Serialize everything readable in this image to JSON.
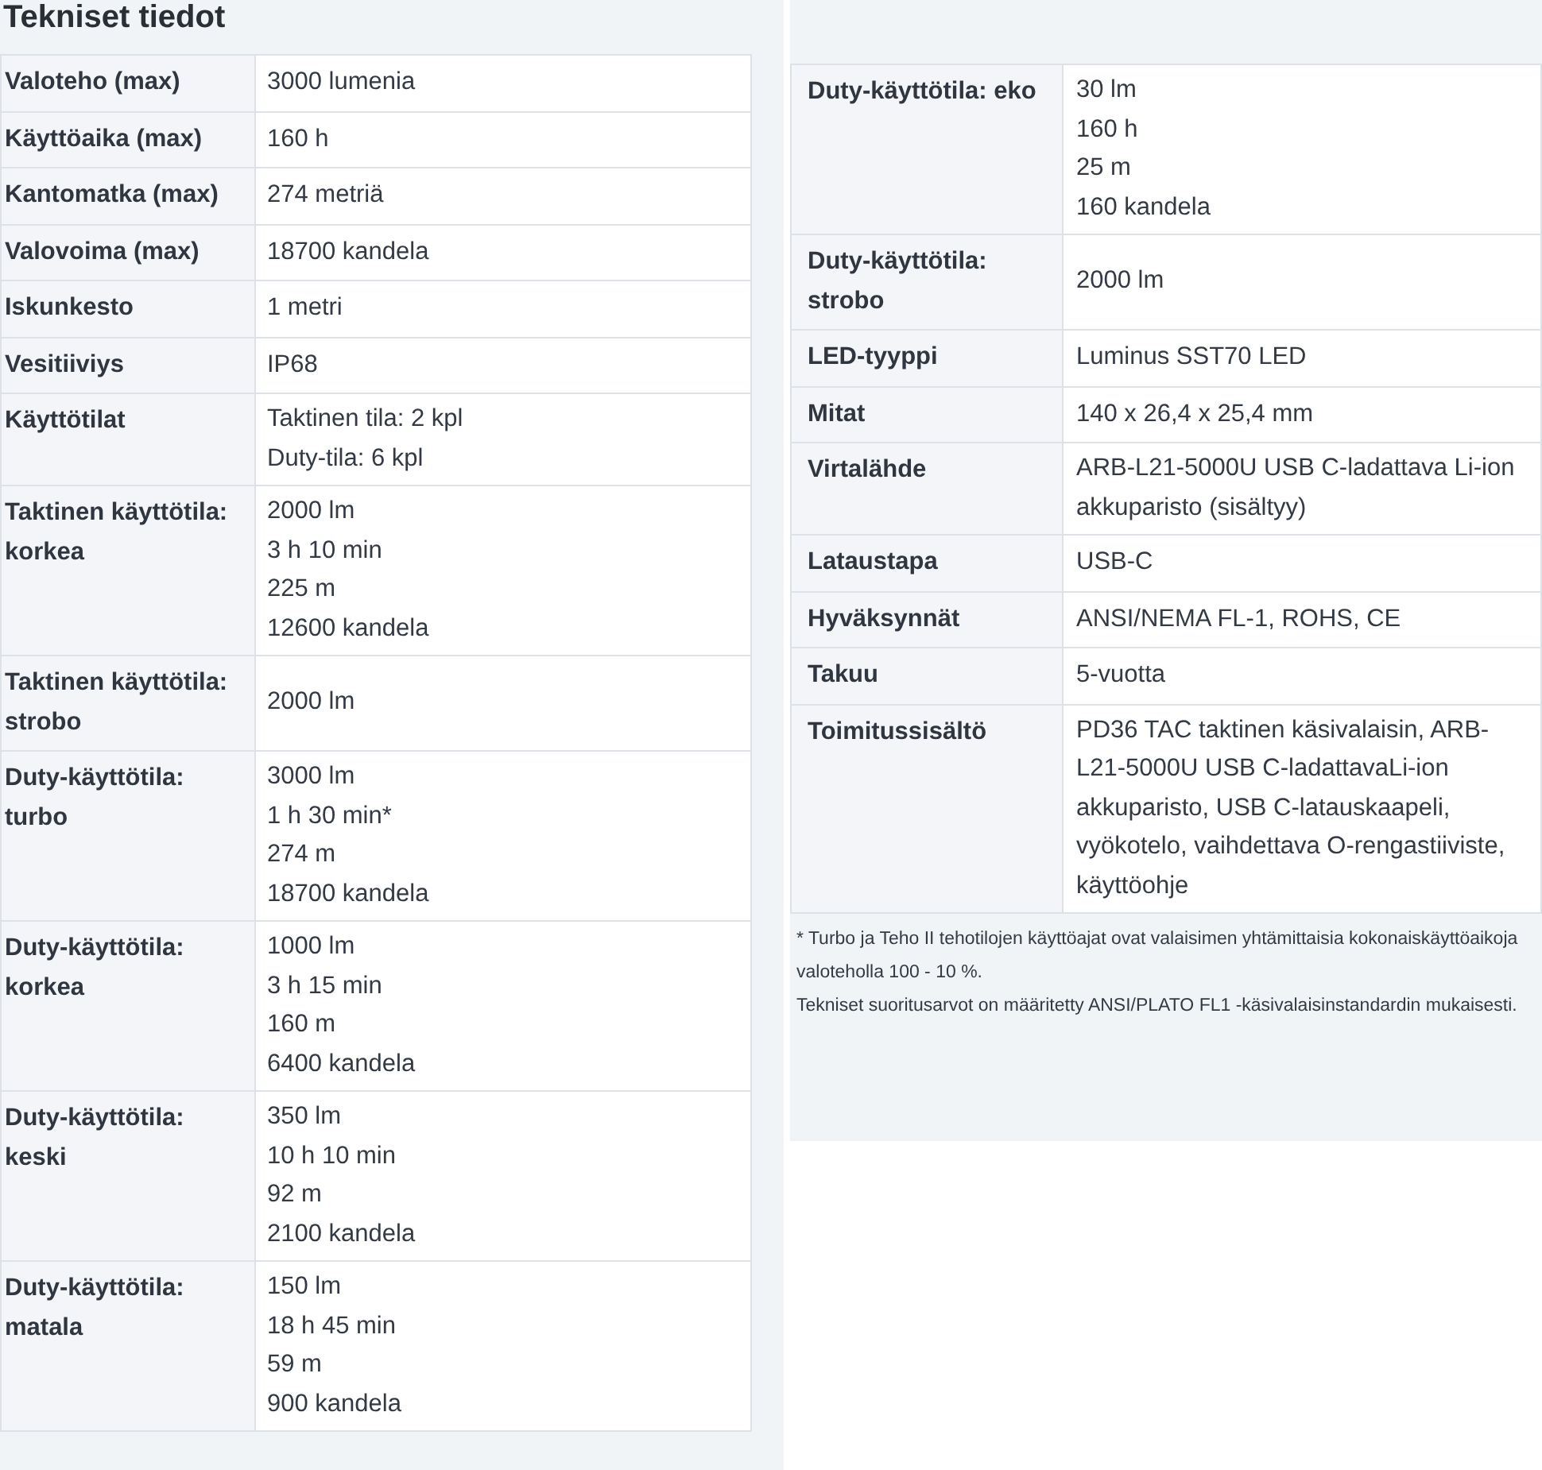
{
  "title": "Tekniset tiedot",
  "left_table": {
    "rows": [
      {
        "label": "Valoteho (max)",
        "value": [
          "3000 lumenia"
        ]
      },
      {
        "label": "Käyttöaika (max)",
        "value": [
          "160 h"
        ]
      },
      {
        "label": "Kantomatka (max)",
        "value": [
          "274 metriä"
        ]
      },
      {
        "label": "Valovoima (max)",
        "value": [
          "18700 kandela"
        ]
      },
      {
        "label": "Iskunkesto",
        "value": [
          "1 metri"
        ]
      },
      {
        "label": "Vesitiiviys",
        "value": [
          "IP68"
        ]
      },
      {
        "label": "Käyttötilat",
        "value": [
          "Taktinen tila: 2 kpl",
          "Duty-tila: 6 kpl"
        ]
      },
      {
        "label": "Taktinen käyttötila: korkea",
        "value": [
          "2000 lm",
          "3 h 10 min",
          "225 m",
          "12600 kandela"
        ]
      },
      {
        "label": "Taktinen käyttötila: strobo",
        "value": [
          "2000 lm"
        ]
      },
      {
        "label": "Duty-käyttötila: turbo",
        "value": [
          "3000 lm",
          "1 h 30 min*",
          "274 m",
          "18700 kandela"
        ]
      },
      {
        "label": "Duty-käyttötila: korkea",
        "value": [
          "1000 lm",
          "3 h 15 min",
          "160 m",
          "6400 kandela"
        ]
      },
      {
        "label": "Duty-käyttötila: keski",
        "value": [
          "350 lm",
          "10 h 10 min",
          "92 m",
          "2100 kandela"
        ]
      },
      {
        "label": "Duty-käyttötila: matala",
        "value": [
          "150 lm",
          "18 h 45 min",
          "59 m",
          "900 kandela"
        ]
      }
    ]
  },
  "right_table": {
    "rows": [
      {
        "label": "Duty-käyttötila: eko",
        "value": [
          "30 lm",
          "160 h",
          "25 m",
          "160 kandela"
        ]
      },
      {
        "label": "Duty-käyttötila: strobo",
        "value": [
          "2000 lm"
        ]
      },
      {
        "label": "LED-tyyppi",
        "value": [
          "Luminus SST70 LED"
        ]
      },
      {
        "label": "Mitat",
        "value": [
          "140 x 26,4 x 25,4 mm"
        ]
      },
      {
        "label": "Virtalähde",
        "value": [
          "ARB-L21-5000U USB C-ladattava Li-ion akkuparisto (sisältyy)"
        ]
      },
      {
        "label": "Lataustapa",
        "value": [
          "USB-C"
        ]
      },
      {
        "label": "Hyväksynnät",
        "value": [
          "ANSI/NEMA FL-1, ROHS, CE"
        ]
      },
      {
        "label": "Takuu",
        "value": [
          "5-vuotta"
        ]
      },
      {
        "label": "Toimitussisältö",
        "value": [
          "PD36 TAC taktinen käsivalaisin, ARB-L21-5000U USB C-ladattavaLi-ion akkuparisto, USB C-latauskaapeli, vyökotelo, vaihdettava O-rengastiiviste, käyttöohje"
        ]
      }
    ]
  },
  "footnotes": [
    "* Turbo ja Teho II tehotilojen käyttöajat ovat valaisimen yhtämittaisia kokonaiskäyttöaikoja valoteholla 100 - 10 %.",
    "Tekniset suoritusarvot on määritetty ANSI/PLATO FL1 -käsivalaisinstandardin mukaisesti."
  ]
}
